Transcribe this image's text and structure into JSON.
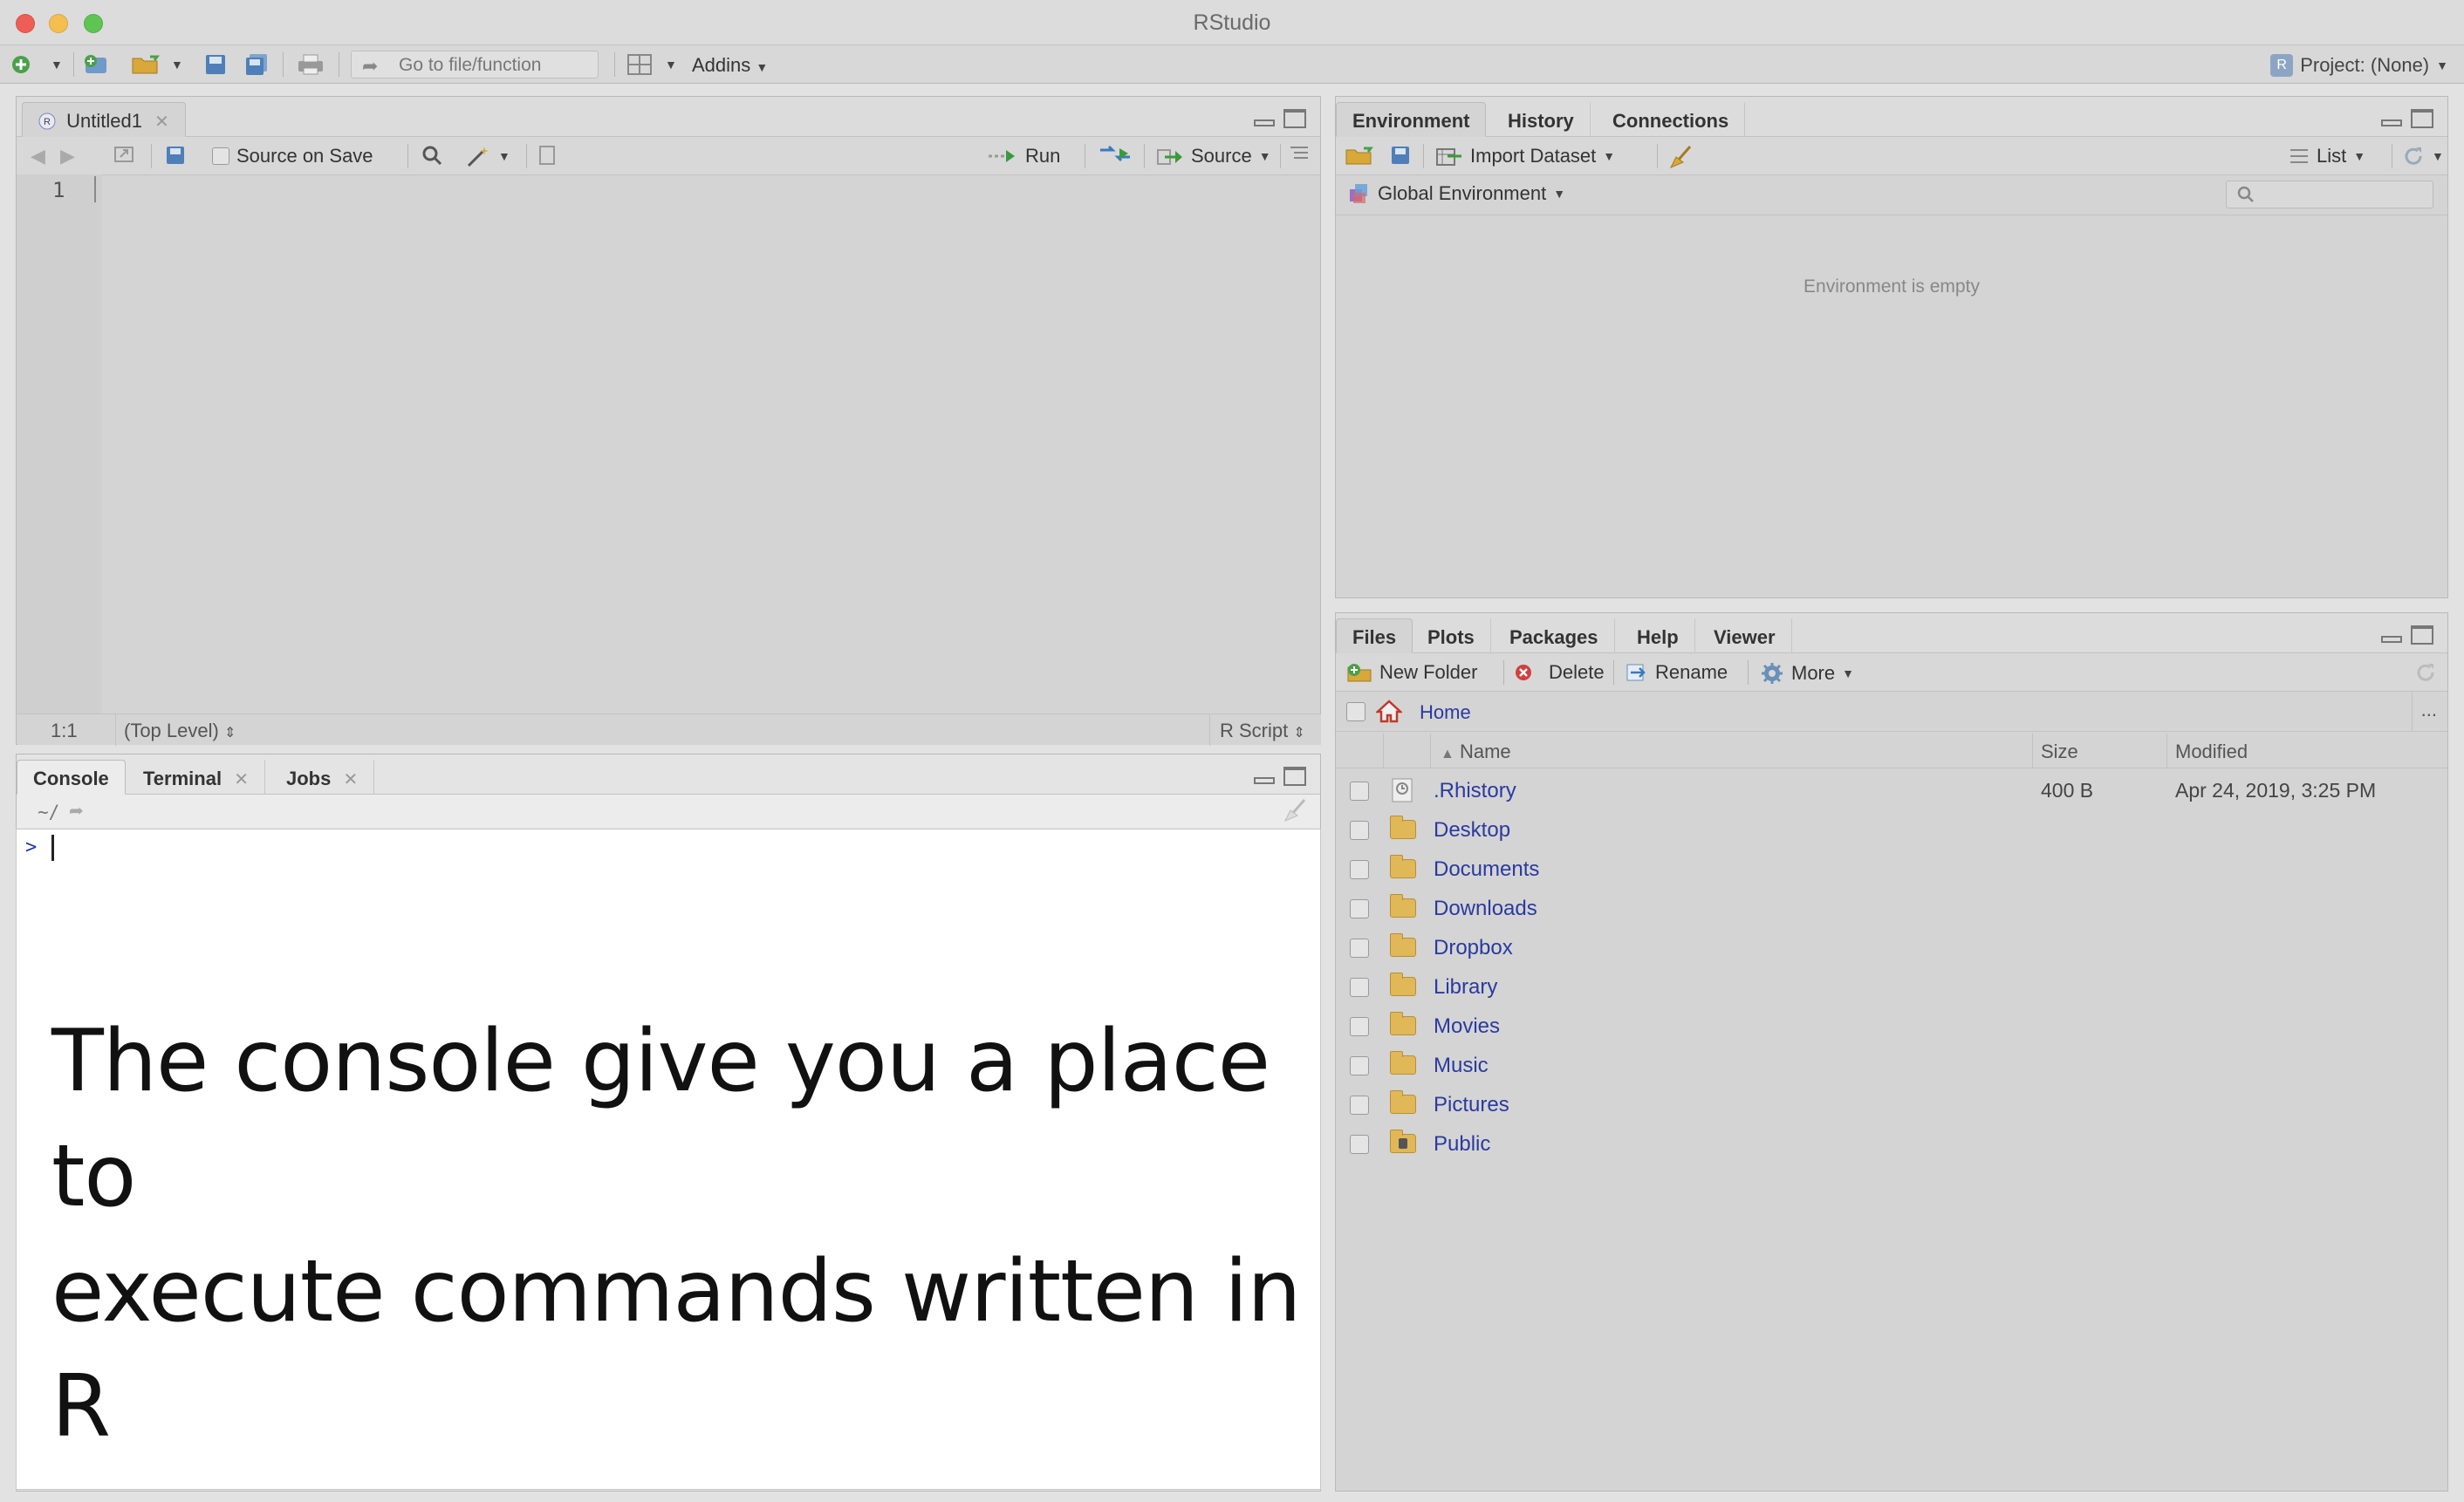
{
  "window": {
    "title": "RStudio"
  },
  "toolbar": {
    "goto_placeholder": "Go to file/function",
    "addins_label": "Addins",
    "project_label": "Project: (None)"
  },
  "source_pane": {
    "tab_label": "Untitled1",
    "source_on_save": "Source on Save",
    "run_label": "Run",
    "source_label": "Source",
    "line_number": "1",
    "status_position": "1:1",
    "status_scope": "(Top Level)",
    "status_filetype": "R Script"
  },
  "console_pane": {
    "tabs": [
      "Console",
      "Terminal",
      "Jobs"
    ],
    "path": "~/",
    "prompt": ">",
    "annotation_line1": "The console give you a place to",
    "annotation_line2": "execute commands written in R"
  },
  "env_pane": {
    "tabs": [
      "Environment",
      "History",
      "Connections"
    ],
    "import_label": "Import Dataset",
    "list_label": "List",
    "global_env_label": "Global Environment",
    "empty_message": "Environment is empty"
  },
  "files_pane": {
    "tabs": [
      "Files",
      "Plots",
      "Packages",
      "Help",
      "Viewer"
    ],
    "new_folder": "New Folder",
    "delete": "Delete",
    "rename": "Rename",
    "more": "More",
    "breadcrumb": "Home",
    "overflow": "...",
    "headers": {
      "name": "Name",
      "size": "Size",
      "modified": "Modified"
    },
    "rows": [
      {
        "name": ".Rhistory",
        "size": "400 B",
        "modified": "Apr 24, 2019, 3:25 PM",
        "icon": "rhistory-file-icon"
      },
      {
        "name": "Desktop",
        "size": "",
        "modified": "",
        "icon": "folder-icon"
      },
      {
        "name": "Documents",
        "size": "",
        "modified": "",
        "icon": "folder-icon"
      },
      {
        "name": "Downloads",
        "size": "",
        "modified": "",
        "icon": "folder-icon"
      },
      {
        "name": "Dropbox",
        "size": "",
        "modified": "",
        "icon": "folder-icon"
      },
      {
        "name": "Library",
        "size": "",
        "modified": "",
        "icon": "folder-icon"
      },
      {
        "name": "Movies",
        "size": "",
        "modified": "",
        "icon": "folder-icon"
      },
      {
        "name": "Music",
        "size": "",
        "modified": "",
        "icon": "folder-icon"
      },
      {
        "name": "Pictures",
        "size": "",
        "modified": "",
        "icon": "folder-icon"
      },
      {
        "name": "Public",
        "size": "",
        "modified": "",
        "icon": "public-folder-icon"
      }
    ]
  },
  "colors": {
    "link_blue": "#2a3aa0",
    "folder_yellow": "#e0b858",
    "close_red": "#ee5e57",
    "minimize_yellow": "#f4bf4f",
    "maximize_green": "#5fc454"
  }
}
